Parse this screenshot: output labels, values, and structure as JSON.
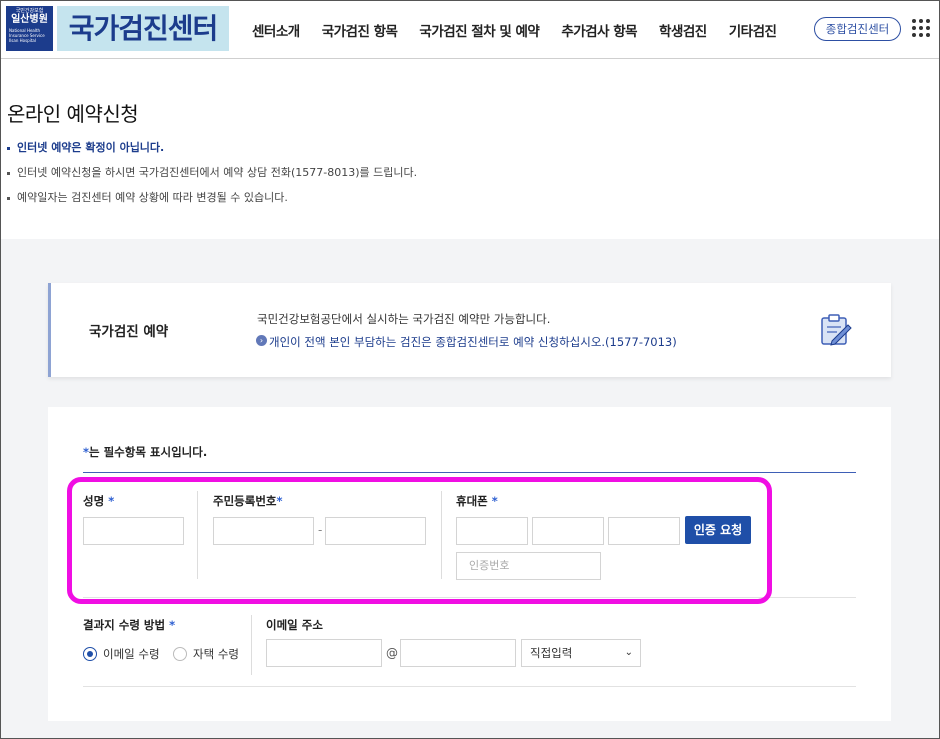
{
  "header": {
    "logo_small": "국민건강보험",
    "logo_name": "일산병원",
    "logo_eng": "National Health Insurance Service Ilsan Hospital",
    "title": "국가검진센터",
    "nav": [
      "센터소개",
      "국가검진 항목",
      "국가검진 절차 및 예약",
      "추가검사 항목",
      "학생검진",
      "기타검진"
    ],
    "cta": "종합검진센터"
  },
  "page": {
    "title": "온라인 예약신청",
    "notices": [
      "인터넷 예약은 확정이 아닙니다.",
      "인터넷 예약신청을 하시면 국가검진센터에서 예약 상담 전화(1577-8013)를 드립니다.",
      "예약일자는 검진센터 예약 상황에 따라 변경될 수 있습니다."
    ]
  },
  "info_card": {
    "title": "국가검진 예약",
    "desc1": "국민건강보험공단에서 실시하는 국가검진 예약만 가능합니다.",
    "desc2": "개인이 전액 본인 부담하는 검진은 종합검진센터로 예약 신청하십시오.(1577-7013)"
  },
  "form": {
    "required_note_star": "*",
    "required_note": "는 필수항목 표시입니다.",
    "name_label": "성명",
    "rrn_label": "주민등록번호",
    "phone_label": "휴대폰",
    "star": "*",
    "dash": "-",
    "verify_button": "인증 요청",
    "verify_code_placeholder": "인증번호",
    "result_label": "결과지 수령 방법",
    "result_options": [
      "이메일 수령",
      "자택 수령"
    ],
    "result_selected": "이메일 수령",
    "email_label": "이메일 주소",
    "at": "@",
    "email_domain_select": "직접입력"
  },
  "colors": {
    "brand_blue": "#1c3c8c",
    "button_blue": "#1f4fa8",
    "highlight_magenta": "#f00ee3",
    "logo_bg": "#c5e4ee"
  }
}
